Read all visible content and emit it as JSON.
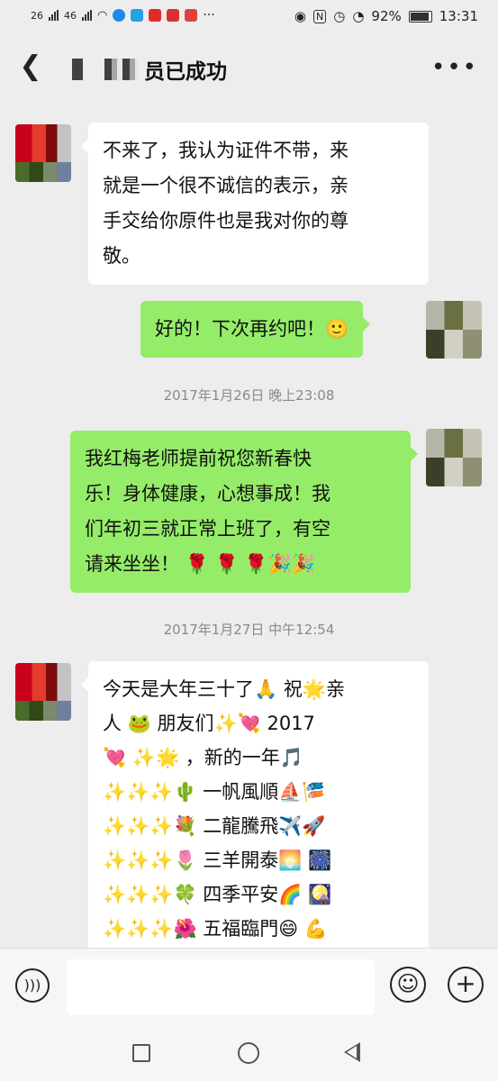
{
  "status_bar": {
    "signal1": "26",
    "signal2": "46",
    "battery": "92%",
    "time": "13:31"
  },
  "header": {
    "title_visible": "员已成功",
    "back_icon": "chevron-left-icon",
    "more_icon": "more-dots-icon"
  },
  "messages": [
    {
      "side": "left",
      "lines": [
        "不来了，我认为证件不带，来",
        "就是一个很不诚信的表示，亲",
        "手交给你原件也是我对你的尊",
        "敬。"
      ]
    },
    {
      "side": "right",
      "lines": [
        "好的！下次再约吧！🙂"
      ]
    },
    {
      "type": "timestamp",
      "text": "2017年1月26日 晚上23:08"
    },
    {
      "side": "right",
      "lines": [
        "我红梅老师提前祝您新春快",
        "乐！身体健康，心想事成！我",
        "们年初三就正常上班了，有空",
        "请来坐坐！ 🌹 🌹 🌹🎉🎉"
      ]
    },
    {
      "type": "timestamp",
      "text": "2017年1月27日 中午12:54"
    },
    {
      "side": "left",
      "lines": [
        "今天是大年三十了🙏  祝🌟亲",
        "人 🐸   朋友们✨💘    2017",
        "💘     ✨🌟     ，新的一年🎵",
        "✨✨✨🌵      一帆風順⛵🎏",
        "✨✨✨💐      二龍騰飛✈️🚀",
        "✨✨✨🌷     三羊開泰🌅    🎆",
        "✨✨✨🍀     四季平安🌈     🎑",
        "✨✨✨🌺     五福臨門😄     💪"
      ]
    }
  ],
  "input": {
    "placeholder": "",
    "voice_icon": "voice-icon",
    "emoji_icon": "emoji-icon",
    "plus_icon": "plus-icon"
  },
  "colors": {
    "background": "#ededed",
    "bubble_incoming": "#ffffff",
    "bubble_outgoing": "#95ec69",
    "timestamp_text": "#8a8a8a"
  }
}
